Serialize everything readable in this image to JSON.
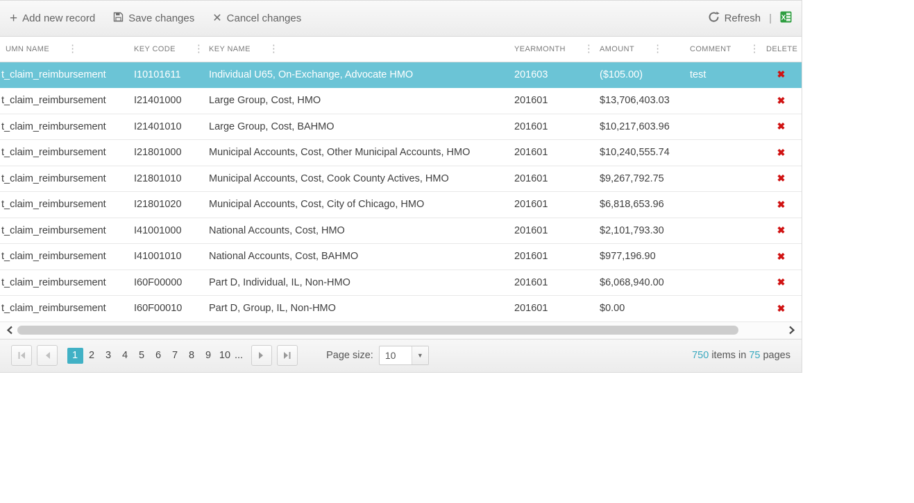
{
  "toolbar": {
    "add_label": "Add new record",
    "save_label": "Save changes",
    "cancel_label": "Cancel changes",
    "refresh_label": "Refresh",
    "separator": "|"
  },
  "grid": {
    "columns": [
      {
        "label": "UMN NAME"
      },
      {
        "label": "KEY CODE"
      },
      {
        "label": "KEY NAME"
      },
      {
        "label": "YEARMONTH"
      },
      {
        "label": "AMOUNT"
      },
      {
        "label": "COMMENT"
      },
      {
        "label": "DELETE"
      }
    ],
    "rows": [
      {
        "column_name": "t_claim_reimbursement",
        "key_code": "I10101611",
        "key_name": "Individual U65, On-Exchange, Advocate HMO",
        "yearmonth": "201603",
        "amount": "($105.00)",
        "comment": "test"
      },
      {
        "column_name": "t_claim_reimbursement",
        "key_code": "I21401000",
        "key_name": "Large Group, Cost, HMO",
        "yearmonth": "201601",
        "amount": "$13,706,403.03",
        "comment": ""
      },
      {
        "column_name": "t_claim_reimbursement",
        "key_code": "I21401010",
        "key_name": "Large Group, Cost, BAHMO",
        "yearmonth": "201601",
        "amount": "$10,217,603.96",
        "comment": ""
      },
      {
        "column_name": "t_claim_reimbursement",
        "key_code": "I21801000",
        "key_name": "Municipal Accounts, Cost, Other Municipal Accounts, HMO",
        "yearmonth": "201601",
        "amount": "$10,240,555.74",
        "comment": ""
      },
      {
        "column_name": "t_claim_reimbursement",
        "key_code": "I21801010",
        "key_name": "Municipal Accounts, Cost, Cook County Actives, HMO",
        "yearmonth": "201601",
        "amount": "$9,267,792.75",
        "comment": ""
      },
      {
        "column_name": "t_claim_reimbursement",
        "key_code": "I21801020",
        "key_name": "Municipal Accounts, Cost, City of Chicago, HMO",
        "yearmonth": "201601",
        "amount": "$6,818,653.96",
        "comment": ""
      },
      {
        "column_name": "t_claim_reimbursement",
        "key_code": "I41001000",
        "key_name": "National Accounts, Cost, HMO",
        "yearmonth": "201601",
        "amount": "$2,101,793.30",
        "comment": ""
      },
      {
        "column_name": "t_claim_reimbursement",
        "key_code": "I41001010",
        "key_name": "National Accounts, Cost, BAHMO",
        "yearmonth": "201601",
        "amount": "$977,196.90",
        "comment": ""
      },
      {
        "column_name": "t_claim_reimbursement",
        "key_code": "I60F00000",
        "key_name": "Part D, Individual, IL, Non-HMO",
        "yearmonth": "201601",
        "amount": "$6,068,940.00",
        "comment": ""
      },
      {
        "column_name": "t_claim_reimbursement",
        "key_code": "I60F00010",
        "key_name": "Part D, Group, IL, Non-HMO",
        "yearmonth": "201601",
        "amount": "$0.00",
        "comment": ""
      }
    ],
    "selected_row_index": 0
  },
  "pager": {
    "pages": [
      "1",
      "2",
      "3",
      "4",
      "5",
      "6",
      "7",
      "8",
      "9",
      "10"
    ],
    "current_page": "1",
    "ellipsis": "...",
    "page_size_label": "Page size:",
    "page_size_value": "10",
    "items_count": "750",
    "items_in_text": "items in",
    "pages_count": "75",
    "pages_text": "pages"
  },
  "colors": {
    "selected_row_bg": "#6bc4d6",
    "pager_selected_bg": "#41b1c5",
    "accent_link": "#3aa9bf",
    "delete_red": "#d01212",
    "excel_green": "#2f9e41"
  }
}
